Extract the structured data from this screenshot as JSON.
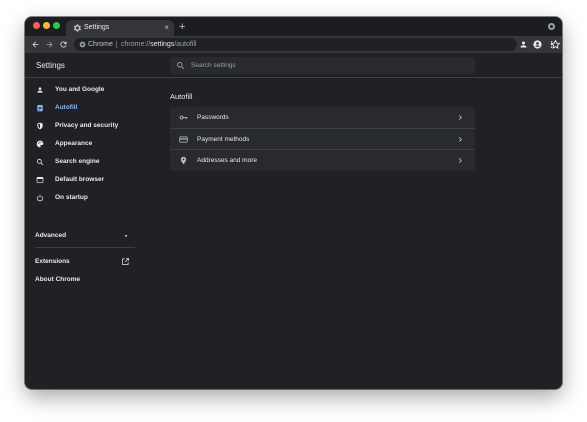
{
  "browser": {
    "tab": {
      "title": "Settings",
      "favicon": "gear-icon",
      "close_glyph": "×"
    },
    "new_tab_glyph": "+",
    "omnibox": {
      "site_label": "Chrome",
      "url_prefix": "chrome://",
      "url_host": "settings",
      "url_path": "/autofill"
    }
  },
  "settings": {
    "title": "Settings",
    "search": {
      "placeholder": "Search settings"
    }
  },
  "sidebar": {
    "items": [
      {
        "label": "You and Google",
        "icon": "person-icon",
        "active": false
      },
      {
        "label": "Autofill",
        "icon": "autofill-clipboard-icon",
        "active": true
      },
      {
        "label": "Privacy and security",
        "icon": "shield-icon",
        "active": false
      },
      {
        "label": "Appearance",
        "icon": "palette-icon",
        "active": false
      },
      {
        "label": "Search engine",
        "icon": "search-icon",
        "active": false
      },
      {
        "label": "Default browser",
        "icon": "browser-window-icon",
        "active": false
      },
      {
        "label": "On startup",
        "icon": "power-icon",
        "active": false
      }
    ],
    "advanced_label": "Advanced",
    "extensions_label": "Extensions",
    "about_label": "About Chrome"
  },
  "main": {
    "section_title": "Autofill",
    "rows": [
      {
        "label": "Passwords",
        "icon": "key-icon"
      },
      {
        "label": "Payment methods",
        "icon": "credit-card-icon"
      },
      {
        "label": "Addresses and more",
        "icon": "location-pin-icon"
      }
    ]
  },
  "colors": {
    "window_bg": "#202124",
    "toolbar_bg": "#35363a",
    "card_bg": "#292a2d",
    "accent": "#8ab4f8",
    "text": "#e8eaed",
    "muted_text": "#9aa0a6"
  }
}
